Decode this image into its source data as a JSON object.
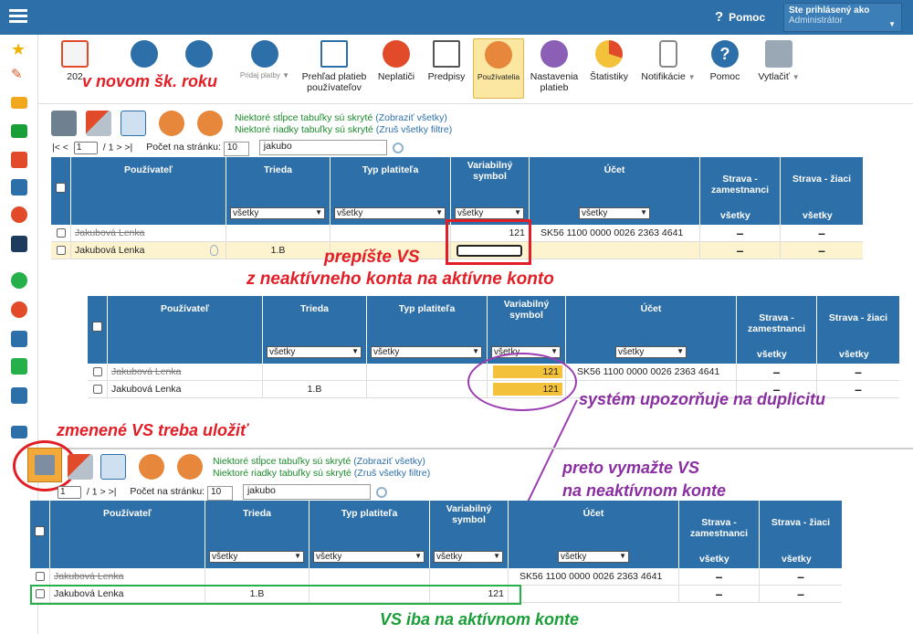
{
  "topbar": {
    "help": "Pomoc",
    "user_line1": "Ste prihlásený ako",
    "user_line2": "Administrátor"
  },
  "toolbar": {
    "items": [
      {
        "label": "202"
      },
      {
        "label": ""
      },
      {
        "label": ""
      },
      {
        "label": "Pridaj platby"
      },
      {
        "label": "Prehľad platieb používateľov"
      },
      {
        "label": "Neplatiči"
      },
      {
        "label": "Predpisy"
      },
      {
        "label": "Používatelia"
      },
      {
        "label": "Nastavenia platieb"
      },
      {
        "label": "Štatistiky"
      },
      {
        "label": "Notifikácie"
      },
      {
        "label": "Pomoc"
      },
      {
        "label": "Vytlačiť"
      }
    ]
  },
  "annotations": {
    "new_year": "v novom šk. roku",
    "rewrite1": "prepíšte VS",
    "rewrite2": "z neaktívneho konta na aktívne konto",
    "duplicate": "systém upozorňuje na duplicitu",
    "save": "zmenené VS treba uložiť",
    "delete1": "preto vymažte VS",
    "delete2": "na neaktívnom konte",
    "only_active": "VS iba na aktívnom konte"
  },
  "notes": {
    "cols_hidden": "Niektoré stĺpce tabuľky sú skryté",
    "show_all": "(Zobraziť všetky)",
    "rows_hidden": "Niektoré riadky tabuľky sú skryté",
    "cancel_filters": "(Zruš všetky filtre)"
  },
  "pager": {
    "nav_left": "|< <",
    "page": "1",
    "of": "/ 1",
    "nav_right": "> >|",
    "per_page_label": "Počet na stránku:",
    "per_page": "10",
    "search": "jakubo"
  },
  "columns": {
    "user": "Používateľ",
    "class": "Trieda",
    "payer": "Typ platiteľa",
    "vs": "Variabilný symbol",
    "account": "Účet",
    "food_staff": "Strava - zamestnanci",
    "food_pupils": "Strava - žiaci",
    "filter_all": "všetky"
  },
  "rows": {
    "inactive_name": "Jakubová Lenka",
    "active_name": "Jakubová Lenka",
    "class": "1.B",
    "vs": "121",
    "iban": "SK56 1100 0000 0026 2363 4641",
    "dash": "–"
  }
}
